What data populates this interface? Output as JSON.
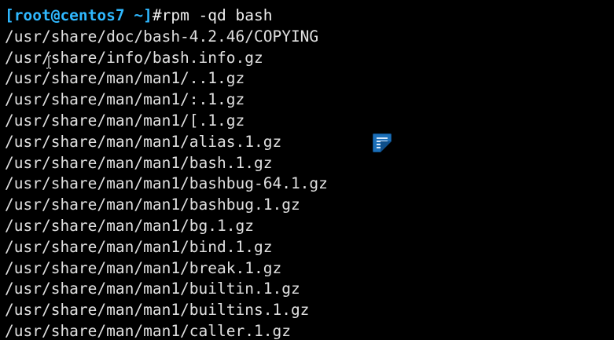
{
  "terminal": {
    "partial_top_line": "         ",
    "prompt": "[root@centos7 ~]",
    "command": "#rpm -qd bash",
    "output": [
      "/usr/share/doc/bash-4.2.46/COPYING",
      "/usr/share/info/bash.info.gz",
      "/usr/share/man/man1/..1.gz",
      "/usr/share/man/man1/:.1.gz",
      "/usr/share/man/man1/[.1.gz",
      "/usr/share/man/man1/alias.1.gz",
      "/usr/share/man/man1/bash.1.gz",
      "/usr/share/man/man1/bashbug-64.1.gz",
      "/usr/share/man/man1/bashbug.1.gz",
      "/usr/share/man/man1/bg.1.gz",
      "/usr/share/man/man1/bind.1.gz",
      "/usr/share/man/man1/break.1.gz",
      "/usr/share/man/man1/builtin.1.gz",
      "/usr/share/man/man1/builtins.1.gz",
      "/usr/share/man/man1/caller.1.gz"
    ]
  },
  "overlay": {
    "cursor_icon": "text-ibeam-cursor-icon",
    "note_icon": "notes-document-icon"
  },
  "colors": {
    "background": "#000000",
    "prompt": "#2fb8ff",
    "text": "#e0e0e0",
    "icon": "#1b6fb8"
  }
}
